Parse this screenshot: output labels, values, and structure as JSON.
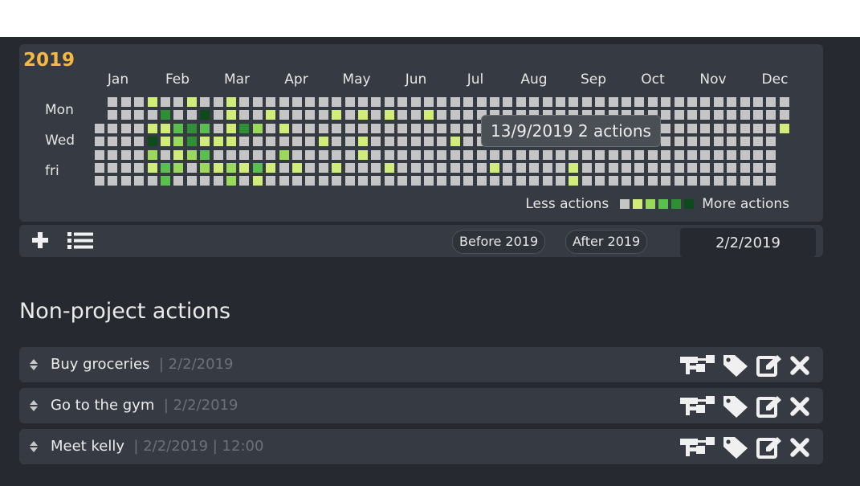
{
  "calendar": {
    "year": "2019",
    "months": [
      "Jan",
      "Feb",
      "Mar",
      "Apr",
      "May",
      "Jun",
      "Jul",
      "Aug",
      "Sep",
      "Oct",
      "Nov",
      "Dec"
    ],
    "day_labels": [
      "Mon",
      "Wed",
      "fri"
    ],
    "legend": {
      "less": "Less actions",
      "more": "More actions"
    },
    "level_colors": [
      "#c5c5c5",
      "#d2ec7a",
      "#9bd95c",
      "#5bbf4f",
      "#2e8f35",
      "#0f4a1c"
    ],
    "tooltip": "13/9/2019 2 actions"
  },
  "toolbar": {
    "before_label": "Before 2019",
    "after_label": "After 2019",
    "date_value": "2/2/2019"
  },
  "section": {
    "title": "Non-project actions"
  },
  "actions": [
    {
      "name": "Buy groceries",
      "meta": "| 2/2/2019"
    },
    {
      "name": "Go to the gym",
      "meta": "| 2/2/2019"
    },
    {
      "name": "Meet kelly",
      "meta": "| 2/2/2019  | 12:00"
    }
  ]
}
